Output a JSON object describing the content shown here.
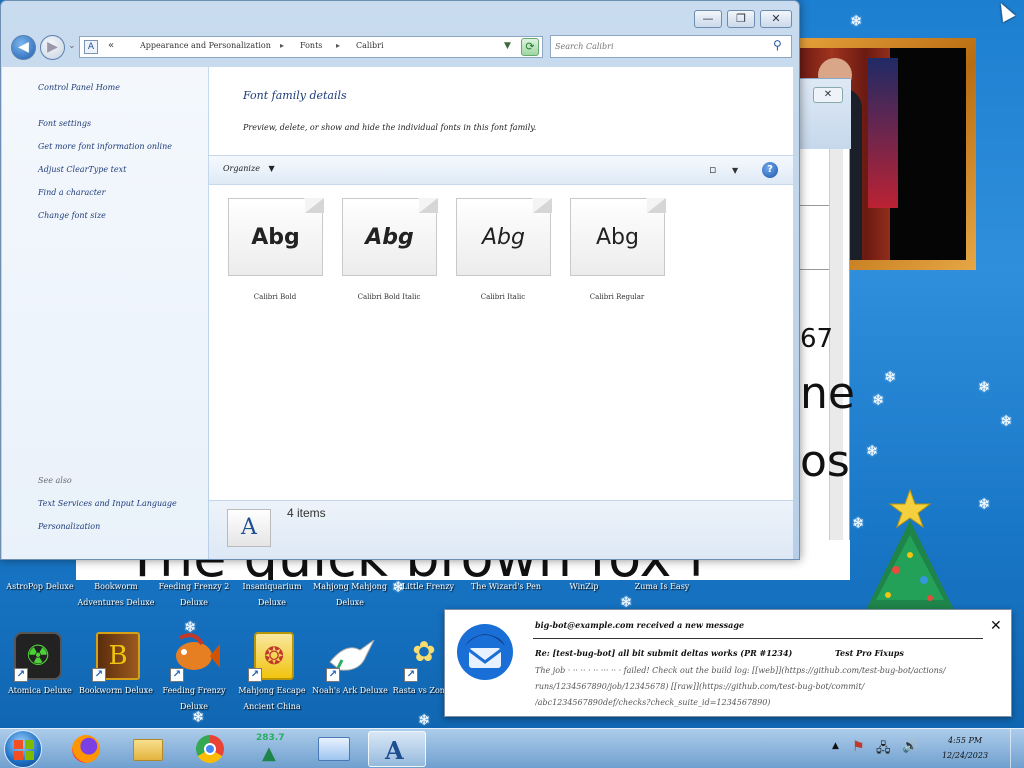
{
  "window": {
    "breadcrumb": [
      "Appearance and Personalization",
      "Fonts",
      "Calibri"
    ],
    "search_placeholder": "Search Calibri",
    "caption_min": "—",
    "caption_max": "❐",
    "caption_close": "✕"
  },
  "sidebar": {
    "home": "Control Panel Home",
    "links": [
      "Font settings",
      "Get more font information online",
      "Adjust ClearType text",
      "Find a character",
      "Change font size"
    ],
    "see_also_title": "See also",
    "see_also": [
      "Text Services and Input Language",
      "Personalization"
    ]
  },
  "content": {
    "title": "Font family details",
    "subtitle": "Preview, delete, or show and hide the individual fonts in this font family.",
    "organize": "Organize",
    "items_count": "4 items",
    "fonts": [
      {
        "sample": "Abg",
        "name": "Calibri Bold",
        "weight": "bold",
        "style": "normal"
      },
      {
        "sample": "Abg",
        "name": "Calibri Bold Italic",
        "weight": "bold",
        "style": "italic"
      },
      {
        "sample": "Abg",
        "name": "Calibri Italic",
        "weight": "normal",
        "style": "italic"
      },
      {
        "sample": "Abg",
        "name": "Calibri Regular",
        "weight": "normal",
        "style": "normal"
      }
    ]
  },
  "background_doc": {
    "num_text": "67",
    "line2": "ne",
    "line3": "os",
    "big_text": "The quick brown fox i"
  },
  "desktop": {
    "row1": [
      {
        "label": "AstroPop Deluxe"
      },
      {
        "label": "Bookworm Adventures Deluxe"
      },
      {
        "label": "Feeding Frenzy 2 Deluxe"
      },
      {
        "label": "Insaniquarium Deluxe"
      },
      {
        "label": "Mahjong Mahjong Deluxe"
      },
      {
        "label": "Little Frenzy"
      },
      {
        "label": "The Wizard's Pen"
      },
      {
        "label": "WinZip"
      },
      {
        "label": "Zuma Is Easy"
      }
    ],
    "row2": [
      {
        "label": "Atomica Deluxe",
        "icon": "atom-game-icon"
      },
      {
        "label": "Bookworm Deluxe",
        "icon": "book-icon"
      },
      {
        "label": "Feeding Frenzy Deluxe",
        "icon": "fish-icon"
      },
      {
        "label": "Mahjong Escape Ancient China",
        "icon": "mahjong-tile-icon"
      },
      {
        "label": "Noah's Ark Deluxe",
        "icon": "dove-icon"
      },
      {
        "label": "Rasta vs Zom",
        "icon": "flower-icon"
      }
    ]
  },
  "notification": {
    "from": "big-bot@example.com received a new message",
    "subject": "Re: [test-bug-bot] all bit submit deltas works (PR #1234)",
    "subject_right": "Test Pro Fixups",
    "body1": "The job · ·· ·· · ·· ··· ·· · failed! Check out the build log: [[web]](https://github.com/test-bug-bot/actions/",
    "body2": "runs/1234567890/job/12345678) [[raw]](https://github.com/test-bug-bot/commit/",
    "body3": "/abc1234567890def/checks?check_suite_id=1234567890)",
    "close": "✕"
  },
  "taskbar": {
    "tree_counter": "283.7",
    "clock_time": "4:55 PM",
    "clock_date": "12/24/2023"
  },
  "colors": {
    "accent": "#1d7fd0",
    "window_chrome": "#b7cfe8",
    "link": "#1e3c7a"
  }
}
